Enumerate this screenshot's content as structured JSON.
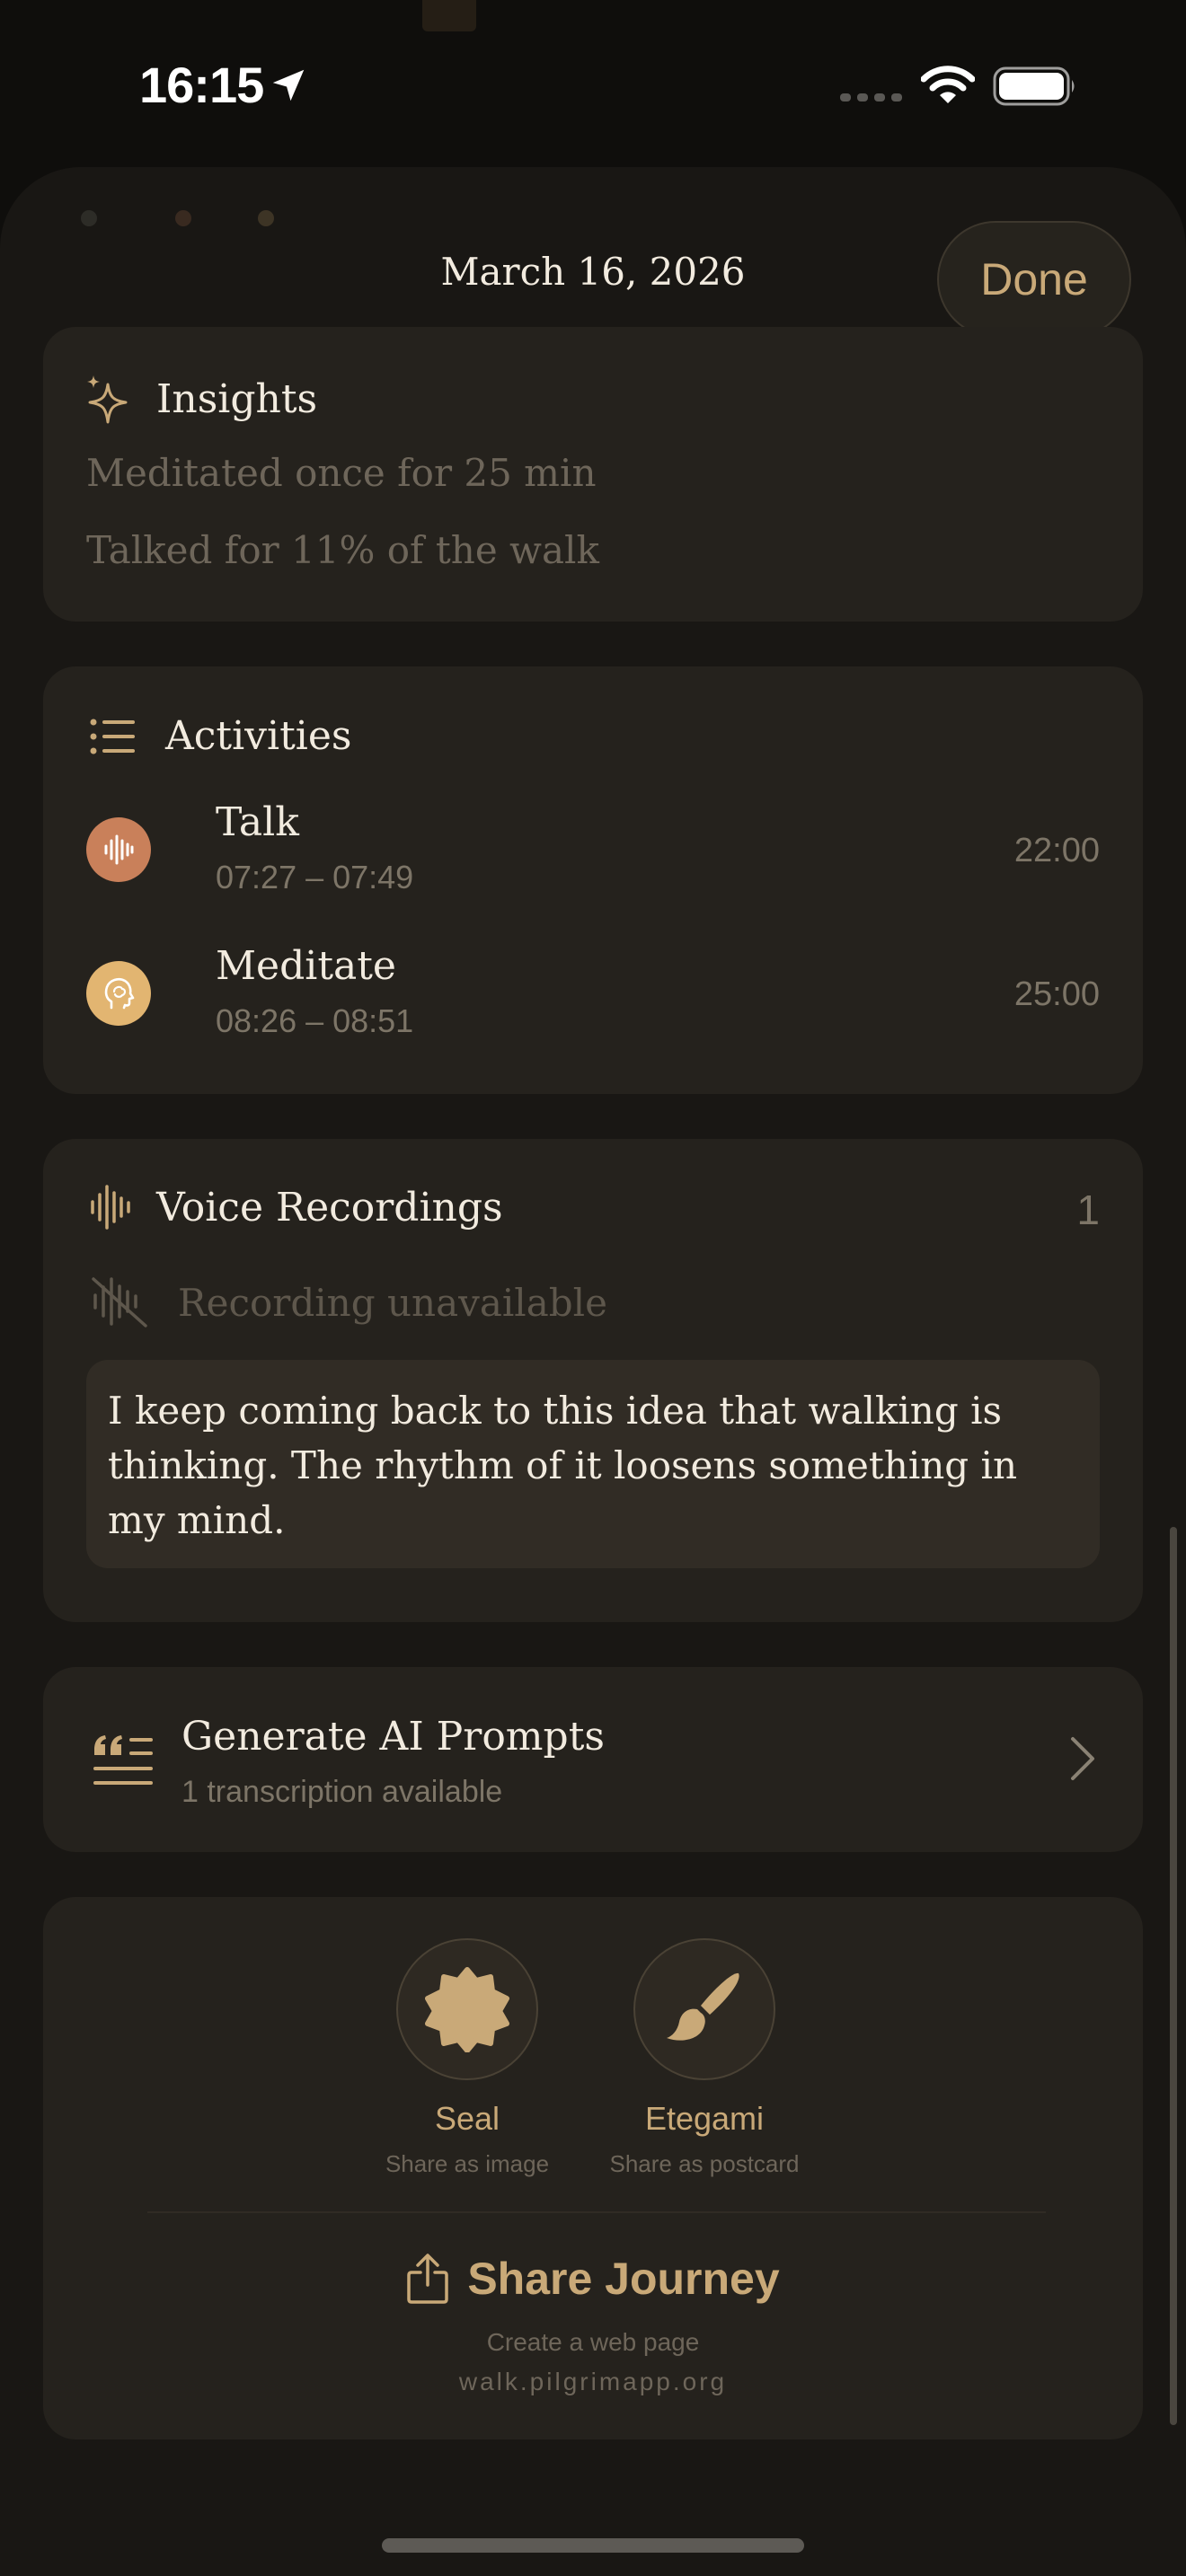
{
  "status_bar": {
    "time": "16:15"
  },
  "header": {
    "title": "March 16, 2026",
    "done_label": "Done"
  },
  "insights": {
    "title": "Insights",
    "lines": [
      "Meditated once for 25 min",
      "Talked for 11% of the walk"
    ]
  },
  "activities": {
    "title": "Activities",
    "items": [
      {
        "name": "Talk",
        "range": "07:27 – 07:49",
        "duration": "22:00",
        "color": "#c9805a"
      },
      {
        "name": "Meditate",
        "range": "08:26 – 08:51",
        "duration": "25:00",
        "color": "#e2b571"
      }
    ]
  },
  "voice_recordings": {
    "title": "Voice Recordings",
    "count": "1",
    "status": "Recording unavailable",
    "transcript": "I keep coming back to this idea that walking is thinking. The rhythm of it loosens something in my mind."
  },
  "ai_prompts": {
    "title": "Generate AI Prompts",
    "subtitle": "1 transcription available"
  },
  "share": {
    "options": [
      {
        "label": "Seal",
        "subtitle": "Share as image",
        "icon": "seal-icon"
      },
      {
        "label": "Etegami",
        "subtitle": "Share as postcard",
        "icon": "paintbrush-icon"
      }
    ],
    "main_label": "Share Journey",
    "description": "Create a web page",
    "url": "walk.pilgrimapp.org"
  },
  "colors": {
    "accent": "#c9a978",
    "background": "#191714",
    "card": "#25221d"
  }
}
